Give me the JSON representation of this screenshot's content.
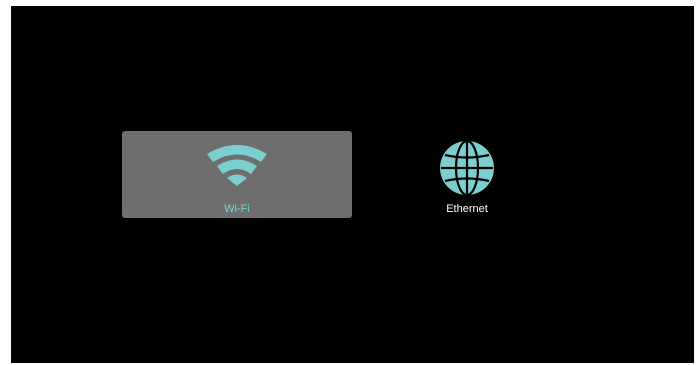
{
  "network_options": [
    {
      "label": "Wi-Fi",
      "icon": "wifi-icon",
      "selected": true
    },
    {
      "label": "Ethernet",
      "icon": "globe-icon",
      "selected": false
    }
  ],
  "colors": {
    "screen_background": "#000000",
    "selected_tile_background": "#6e6e6e",
    "icon_accent": "#7ccfcf",
    "unselected_label": "#ffffff"
  }
}
